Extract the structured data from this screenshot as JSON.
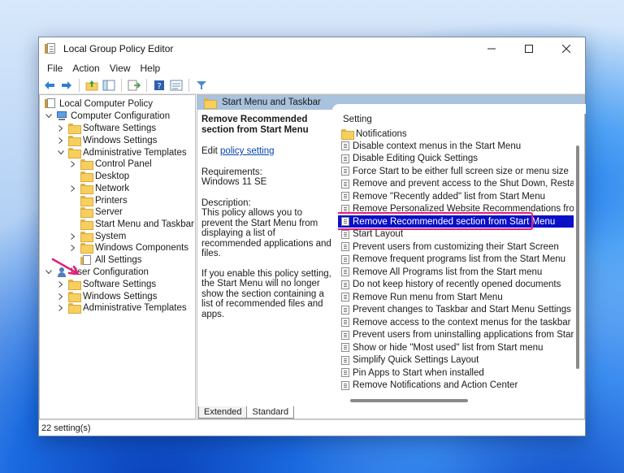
{
  "window": {
    "title": "Local Group Policy Editor"
  },
  "menu": [
    "File",
    "Action",
    "View",
    "Help"
  ],
  "toolbar": {
    "icons": [
      "back-arrow-icon",
      "forward-arrow-icon",
      "up-folder-icon",
      "show-hide-tree-icon",
      "export-list-icon",
      "help-icon",
      "properties-icon",
      "filter-icon"
    ]
  },
  "tree": {
    "root": "Local Computer Policy",
    "computer_config": "Computer Configuration",
    "cc_software": "Software Settings",
    "cc_windows": "Windows Settings",
    "cc_admin": "Administrative Templates",
    "control_panel": "Control Panel",
    "desktop": "Desktop",
    "network": "Network",
    "printers": "Printers",
    "server": "Server",
    "start_menu": "Start Menu and Taskbar",
    "system": "System",
    "windows_components": "Windows Components",
    "all_settings": "All Settings",
    "user_config": "User Configuration",
    "uc_software": "Software Settings",
    "uc_windows": "Windows Settings",
    "uc_admin": "Administrative Templates"
  },
  "details": {
    "header": "Start Menu and Taskbar",
    "title": "Remove Recommended section from Start Menu",
    "edit_prefix": "Edit",
    "edit_link": "policy setting",
    "req_label": "Requirements:",
    "req_value": "Windows 11 SE",
    "desc_label": "Description:",
    "desc_p1": "This policy allows you to prevent the Start Menu from displaying a list of recommended applications and files.",
    "desc_p2": "If you enable this policy setting, the Start Menu will no longer show the section containing a list of recommended files and apps."
  },
  "list": {
    "column": "Setting",
    "folder": "Notifications",
    "items": [
      "Disable context menus in the Start Menu",
      "Disable Editing Quick Settings",
      "Force Start to be either full screen size or menu size",
      "Remove and prevent access to the Shut Down, Restart, Sleep, ...",
      "Remove \"Recently added\" list from Start Menu",
      "Remove Personalized Website Recommendations from the R...",
      "Remove Recommended section from Start Menu",
      "Start Layout",
      "Prevent users from customizing their Start Screen",
      "Remove frequent programs list from the Start Menu",
      "Remove All Programs list from the Start menu",
      "Do not keep history of recently opened documents",
      "Remove Run menu from Start Menu",
      "Prevent changes to Taskbar and Start Menu Settings",
      "Remove access to the context menus for the taskbar",
      "Prevent users from uninstalling applications from Start",
      "Show or hide \"Most used\" list from Start menu",
      "Simplify Quick Settings Layout",
      "Pin Apps to Start when installed",
      "Remove Notifications and Action Center"
    ],
    "selected_index": 6
  },
  "tabs": [
    "Extended",
    "Standard"
  ],
  "status": "22 setting(s)",
  "colors": {
    "selection": "#0a10c8",
    "highlight_box": "#e0207a",
    "header": "#a9c2dd",
    "annotation_arrow": "#e0207a"
  }
}
